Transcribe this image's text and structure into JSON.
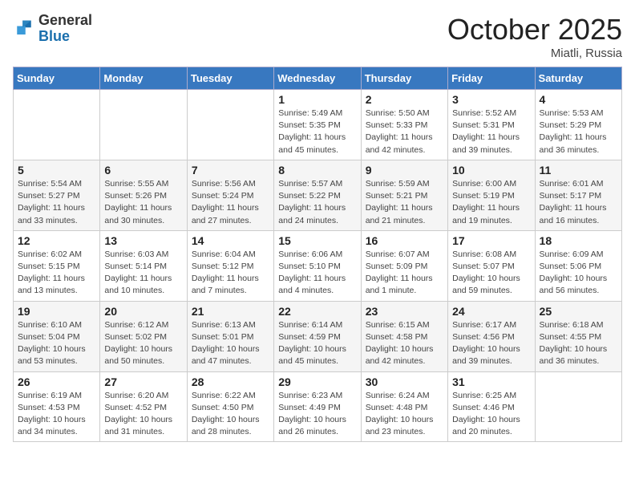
{
  "logo": {
    "general": "General",
    "blue": "Blue"
  },
  "header": {
    "month": "October 2025",
    "location": "Miatli, Russia"
  },
  "weekdays": [
    "Sunday",
    "Monday",
    "Tuesday",
    "Wednesday",
    "Thursday",
    "Friday",
    "Saturday"
  ],
  "weeks": [
    [
      {
        "day": "",
        "info": ""
      },
      {
        "day": "",
        "info": ""
      },
      {
        "day": "",
        "info": ""
      },
      {
        "day": "1",
        "info": "Sunrise: 5:49 AM\nSunset: 5:35 PM\nDaylight: 11 hours and 45 minutes."
      },
      {
        "day": "2",
        "info": "Sunrise: 5:50 AM\nSunset: 5:33 PM\nDaylight: 11 hours and 42 minutes."
      },
      {
        "day": "3",
        "info": "Sunrise: 5:52 AM\nSunset: 5:31 PM\nDaylight: 11 hours and 39 minutes."
      },
      {
        "day": "4",
        "info": "Sunrise: 5:53 AM\nSunset: 5:29 PM\nDaylight: 11 hours and 36 minutes."
      }
    ],
    [
      {
        "day": "5",
        "info": "Sunrise: 5:54 AM\nSunset: 5:27 PM\nDaylight: 11 hours and 33 minutes."
      },
      {
        "day": "6",
        "info": "Sunrise: 5:55 AM\nSunset: 5:26 PM\nDaylight: 11 hours and 30 minutes."
      },
      {
        "day": "7",
        "info": "Sunrise: 5:56 AM\nSunset: 5:24 PM\nDaylight: 11 hours and 27 minutes."
      },
      {
        "day": "8",
        "info": "Sunrise: 5:57 AM\nSunset: 5:22 PM\nDaylight: 11 hours and 24 minutes."
      },
      {
        "day": "9",
        "info": "Sunrise: 5:59 AM\nSunset: 5:21 PM\nDaylight: 11 hours and 21 minutes."
      },
      {
        "day": "10",
        "info": "Sunrise: 6:00 AM\nSunset: 5:19 PM\nDaylight: 11 hours and 19 minutes."
      },
      {
        "day": "11",
        "info": "Sunrise: 6:01 AM\nSunset: 5:17 PM\nDaylight: 11 hours and 16 minutes."
      }
    ],
    [
      {
        "day": "12",
        "info": "Sunrise: 6:02 AM\nSunset: 5:15 PM\nDaylight: 11 hours and 13 minutes."
      },
      {
        "day": "13",
        "info": "Sunrise: 6:03 AM\nSunset: 5:14 PM\nDaylight: 11 hours and 10 minutes."
      },
      {
        "day": "14",
        "info": "Sunrise: 6:04 AM\nSunset: 5:12 PM\nDaylight: 11 hours and 7 minutes."
      },
      {
        "day": "15",
        "info": "Sunrise: 6:06 AM\nSunset: 5:10 PM\nDaylight: 11 hours and 4 minutes."
      },
      {
        "day": "16",
        "info": "Sunrise: 6:07 AM\nSunset: 5:09 PM\nDaylight: 11 hours and 1 minute."
      },
      {
        "day": "17",
        "info": "Sunrise: 6:08 AM\nSunset: 5:07 PM\nDaylight: 10 hours and 59 minutes."
      },
      {
        "day": "18",
        "info": "Sunrise: 6:09 AM\nSunset: 5:06 PM\nDaylight: 10 hours and 56 minutes."
      }
    ],
    [
      {
        "day": "19",
        "info": "Sunrise: 6:10 AM\nSunset: 5:04 PM\nDaylight: 10 hours and 53 minutes."
      },
      {
        "day": "20",
        "info": "Sunrise: 6:12 AM\nSunset: 5:02 PM\nDaylight: 10 hours and 50 minutes."
      },
      {
        "day": "21",
        "info": "Sunrise: 6:13 AM\nSunset: 5:01 PM\nDaylight: 10 hours and 47 minutes."
      },
      {
        "day": "22",
        "info": "Sunrise: 6:14 AM\nSunset: 4:59 PM\nDaylight: 10 hours and 45 minutes."
      },
      {
        "day": "23",
        "info": "Sunrise: 6:15 AM\nSunset: 4:58 PM\nDaylight: 10 hours and 42 minutes."
      },
      {
        "day": "24",
        "info": "Sunrise: 6:17 AM\nSunset: 4:56 PM\nDaylight: 10 hours and 39 minutes."
      },
      {
        "day": "25",
        "info": "Sunrise: 6:18 AM\nSunset: 4:55 PM\nDaylight: 10 hours and 36 minutes."
      }
    ],
    [
      {
        "day": "26",
        "info": "Sunrise: 6:19 AM\nSunset: 4:53 PM\nDaylight: 10 hours and 34 minutes."
      },
      {
        "day": "27",
        "info": "Sunrise: 6:20 AM\nSunset: 4:52 PM\nDaylight: 10 hours and 31 minutes."
      },
      {
        "day": "28",
        "info": "Sunrise: 6:22 AM\nSunset: 4:50 PM\nDaylight: 10 hours and 28 minutes."
      },
      {
        "day": "29",
        "info": "Sunrise: 6:23 AM\nSunset: 4:49 PM\nDaylight: 10 hours and 26 minutes."
      },
      {
        "day": "30",
        "info": "Sunrise: 6:24 AM\nSunset: 4:48 PM\nDaylight: 10 hours and 23 minutes."
      },
      {
        "day": "31",
        "info": "Sunrise: 6:25 AM\nSunset: 4:46 PM\nDaylight: 10 hours and 20 minutes."
      },
      {
        "day": "",
        "info": ""
      }
    ]
  ]
}
